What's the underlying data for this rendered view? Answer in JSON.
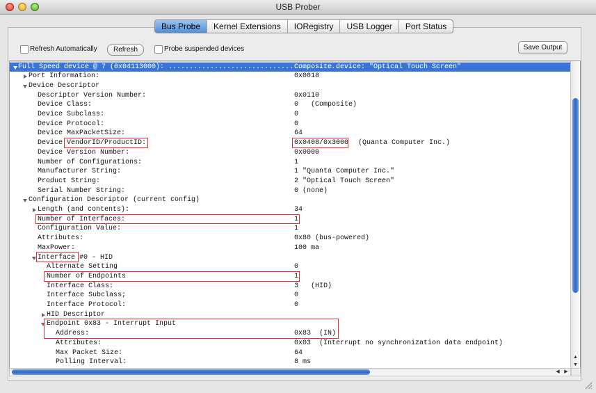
{
  "window": {
    "title": "USB Prober"
  },
  "tabs": [
    "Bus Probe",
    "Kernel Extensions",
    "IORegistry",
    "USB Logger",
    "Port Status"
  ],
  "toolbar": {
    "refresh_auto_label": "Refresh Automatically",
    "refresh_button": "Refresh",
    "probe_suspended_label": "Probe suspended devices",
    "save_output": "Save Output"
  },
  "rows": [
    {
      "k": "Full Speed device @ 7 (0x04113000): .............................................",
      "v": "Composite device: \"Optical Touch Screen\"",
      "v2": ""
    },
    {
      "k": "Port Information:",
      "v": "0x0018",
      "v2": ""
    },
    {
      "k": "Device Descriptor",
      "v": "",
      "v2": ""
    },
    {
      "k": "Descriptor Version Number:",
      "v": "0x0110",
      "v2": ""
    },
    {
      "k": "Device Class:",
      "v": "0   (Composite)",
      "v2": ""
    },
    {
      "k": "Device Subclass:",
      "v": "0",
      "v2": ""
    },
    {
      "k": "Device Protocol:",
      "v": "0",
      "v2": ""
    },
    {
      "k": "Device MaxPacketSize:",
      "v": "64",
      "v2": ""
    },
    {
      "k": "Device VendorID/ProductID:",
      "v": "0x0408/0x3000",
      "v2": "(Quanta Computer Inc.)"
    },
    {
      "k": "Device Version Number:",
      "v": "0x0000",
      "v2": ""
    },
    {
      "k": "Number of Configurations:",
      "v": "1",
      "v2": ""
    },
    {
      "k": "Manufacturer String:",
      "v": "1 \"Quanta Computer Inc.\"",
      "v2": ""
    },
    {
      "k": "Product String:",
      "v": "2 \"Optical Touch Screen\"",
      "v2": ""
    },
    {
      "k": "Serial Number String:",
      "v": "0 (none)",
      "v2": ""
    },
    {
      "k": "Configuration Descriptor (current config)",
      "v": "",
      "v2": ""
    },
    {
      "k": "Length (and contents):",
      "v": "34",
      "v2": ""
    },
    {
      "k": "Number of Interfaces:",
      "v": "1",
      "v2": ""
    },
    {
      "k": "Configuration Value:",
      "v": "1",
      "v2": ""
    },
    {
      "k": "Attributes:",
      "v": "0x80 (bus-powered)",
      "v2": ""
    },
    {
      "k": "MaxPower:",
      "v": "100 ma",
      "v2": ""
    },
    {
      "k": "Interface #0 - HID",
      "v": "",
      "v2": ""
    },
    {
      "k": "Alternate Setting",
      "v": "0",
      "v2": ""
    },
    {
      "k": "Number of Endpoints",
      "v": "1",
      "v2": ""
    },
    {
      "k": "Interface Class:",
      "v": "3   (HID)",
      "v2": ""
    },
    {
      "k": "Interface Subclass;",
      "v": "0",
      "v2": ""
    },
    {
      "k": "Interface Protocol:",
      "v": "0",
      "v2": ""
    },
    {
      "k": "HID Descriptor",
      "v": "",
      "v2": ""
    },
    {
      "k": "Endpoint 0x83 - Interrupt Input",
      "v": "",
      "v2": ""
    },
    {
      "k": "Address:",
      "v": "0x83  (IN)",
      "v2": ""
    },
    {
      "k": "Attributes:",
      "v": "0x03  (Interrupt no synchronization data endpoint)",
      "v2": ""
    },
    {
      "k": "Max Packet Size:",
      "v": "64",
      "v2": ""
    },
    {
      "k": "Polling Interval:",
      "v": "8 ms",
      "v2": ""
    }
  ],
  "colors": {
    "selection": "#3875d7",
    "highlight": "#e03030",
    "tab_active": "#4f8fdc"
  },
  "icons": [
    "disclosure-right-icon",
    "disclosure-down-icon",
    "scroll-up-arrow-icon",
    "scroll-down-arrow-icon",
    "scroll-left-arrow-icon",
    "scroll-right-arrow-icon",
    "resize-grip-icon"
  ]
}
